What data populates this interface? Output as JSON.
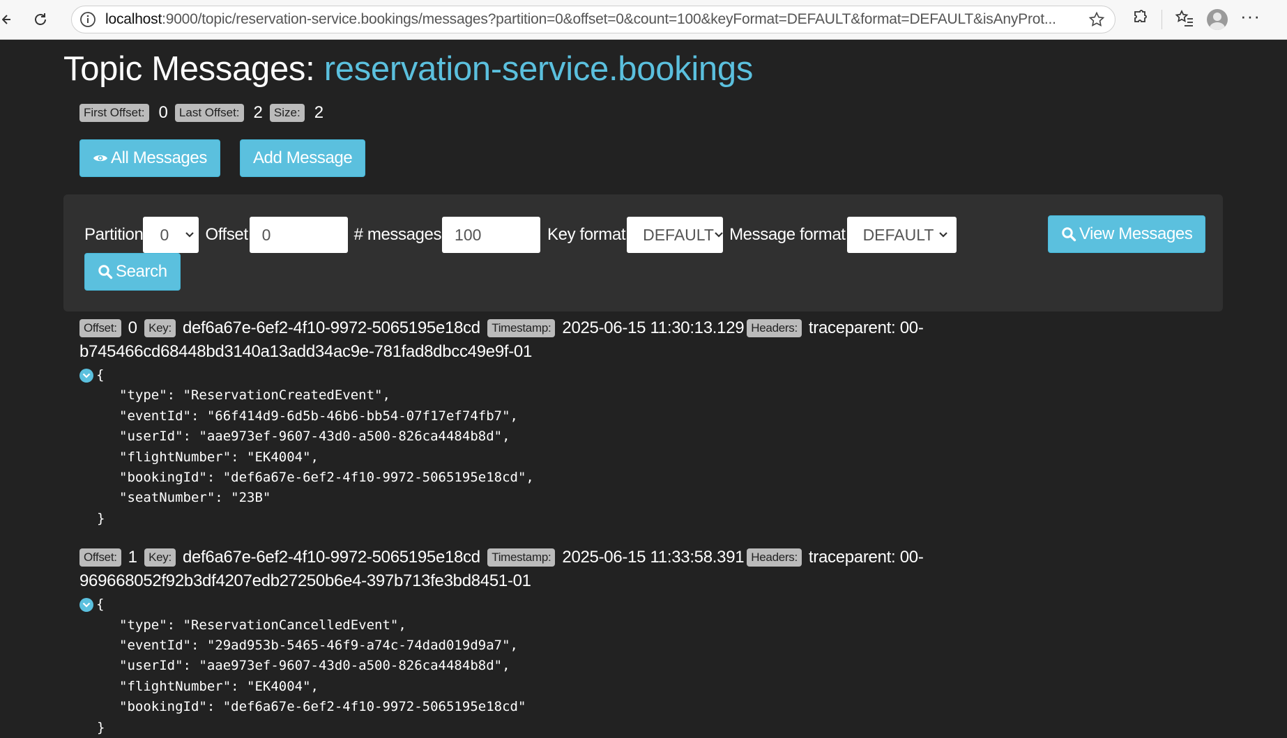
{
  "browser": {
    "url_host": "localhost",
    "url_rest": ":9000/topic/reservation-service.bookings/messages?partition=0&offset=0&count=100&keyFormat=DEFAULT&format=DEFAULT&isAnyProt..."
  },
  "header": {
    "title_prefix": "Topic Messages: ",
    "topic_name": "reservation-service.bookings"
  },
  "stats": {
    "first_offset_label": "First Offset:",
    "first_offset": "0",
    "last_offset_label": "Last Offset:",
    "last_offset": "2",
    "size_label": "Size:",
    "size": "2"
  },
  "actions": {
    "all_messages": "All Messages",
    "add_message": "Add Message"
  },
  "form": {
    "partition_label": "Partition",
    "partition_value": "0",
    "offset_label": "Offset",
    "offset_value": "0",
    "count_label": "# messages",
    "count_value": "100",
    "key_format_label": "Key format",
    "key_format_value": "DEFAULT",
    "message_format_label": "Message format",
    "message_format_value": "DEFAULT",
    "view_button": "View Messages",
    "search_button": "Search"
  },
  "labels": {
    "offset": "Offset:",
    "key": "Key:",
    "timestamp": "Timestamp:",
    "headers": "Headers:"
  },
  "messages": [
    {
      "offset": "0",
      "key": "def6a67e-6ef2-4f10-9972-5065195e18cd",
      "timestamp": "2025-06-15 11:30:13.129",
      "headers": "traceparent: 00-b745466cd68448bd3140a13add34ac9e-781fad8dbcc49e9f-01",
      "open_brace": "{",
      "lines": [
        "\"type\": \"ReservationCreatedEvent\",",
        "\"eventId\": \"66f414d9-6d5b-46b6-bb54-07f17ef74fb7\",",
        "\"userId\": \"aae973ef-9607-43d0-a500-826ca4484b8d\",",
        "\"flightNumber\": \"EK4004\",",
        "\"bookingId\": \"def6a67e-6ef2-4f10-9972-5065195e18cd\",",
        "\"seatNumber\": \"23B\""
      ],
      "close_brace": "}"
    },
    {
      "offset": "1",
      "key": "def6a67e-6ef2-4f10-9972-5065195e18cd",
      "timestamp": "2025-06-15 11:33:58.391",
      "headers": "traceparent: 00-969668052f92b3df4207edb27250b6e4-397b713fe3bd8451-01",
      "open_brace": "{",
      "lines": [
        "\"type\": \"ReservationCancelledEvent\",",
        "\"eventId\": \"29ad953b-5465-46f9-a74c-74dad019d9a7\",",
        "\"userId\": \"aae973ef-9607-43d0-a500-826ca4484b8d\",",
        "\"flightNumber\": \"EK4004\",",
        "\"bookingId\": \"def6a67e-6ef2-4f10-9972-5065195e18cd\""
      ],
      "close_brace": "}"
    }
  ]
}
